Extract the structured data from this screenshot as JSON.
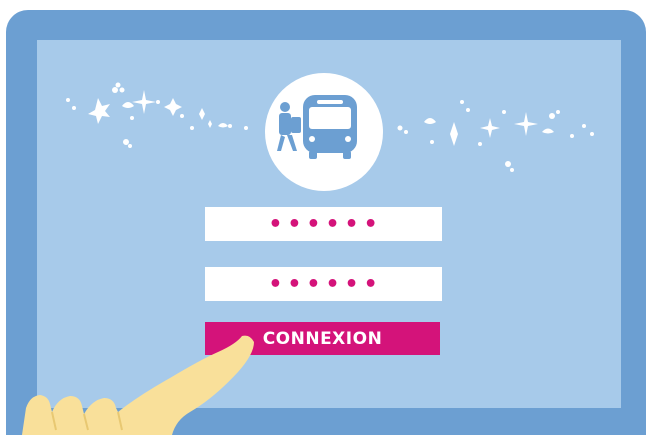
{
  "login": {
    "username_value": "••••••",
    "password_value": "••••••",
    "submit_label": "CONNEXION"
  },
  "colors": {
    "tablet_frame": "#6c9fd2",
    "screen_bg": "#a7caea",
    "accent": "#d4137a",
    "logo_blue": "#6c9fd2",
    "hand": "#f9e09a"
  },
  "icons": {
    "logo": "bus-with-hiker-icon",
    "left_decoration": "celtic-sparkles-icon",
    "right_decoration": "celtic-sparkles-icon",
    "hand": "pointing-hand-icon"
  }
}
